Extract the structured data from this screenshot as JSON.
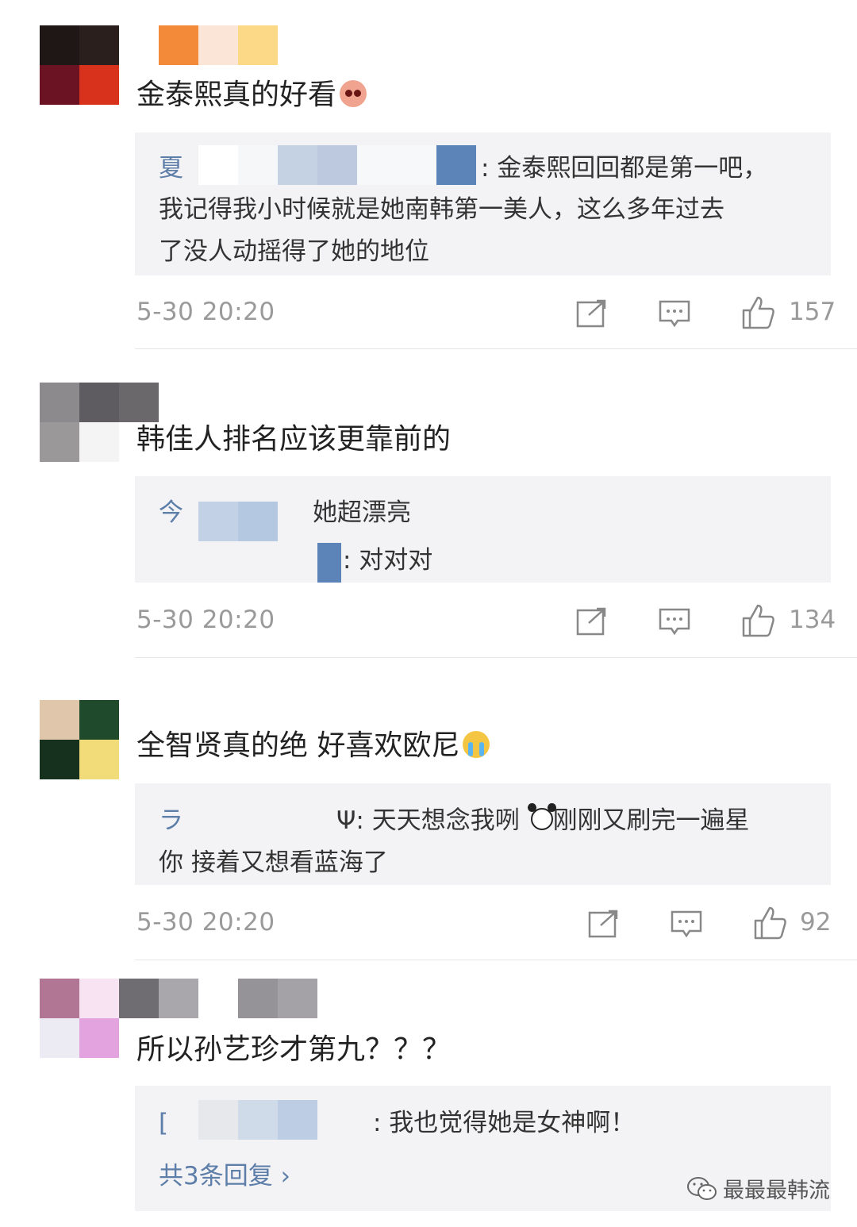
{
  "comments": [
    {
      "text": "金泰熙真的好看",
      "emoji": "pink-face-emoji",
      "reply": {
        "name_visible": "夏",
        "lines": [
          ": 金泰熙回回都是第一吧，",
          "我记得我小时候就是她南韩第一美人，这么多年过去",
          "了没人动摇得了她的地位"
        ]
      },
      "time": "5-30 20:20",
      "likes": "157"
    },
    {
      "text": "韩佳人排名应该更靠前的",
      "reply": {
        "name_visible": "今",
        "lines": [
          "她超漂亮",
          ": 对对对"
        ]
      },
      "time": "5-30 20:20",
      "likes": "134"
    },
    {
      "text": "全智贤真的绝 好喜欢欧尼",
      "emoji": "crying-face-emoji",
      "reply": {
        "name_visible": "ラ",
        "lines": [
          "Ψ: 天天想念我咧 ",
          "刚刚又刷完一遍星",
          "你 接着又想看蓝海了"
        ]
      },
      "time": "5-30 20:20",
      "likes": "92"
    },
    {
      "text": "所以孙艺珍才第九？？？",
      "reply": {
        "name_visible": "[",
        "lines": [
          ": 我也觉得她是女神啊！"
        ],
        "more": "共3条回复 ›"
      }
    }
  ],
  "watermark": "最最最韩流",
  "icons": {
    "share": "share-icon",
    "comment": "comment-icon",
    "like": "like-icon",
    "wechat": "wechat-icon"
  },
  "colors": {
    "reply_name": "#5d7ea9",
    "meta_gray": "#9a9a9a",
    "reply_bg": "#f3f3f5"
  }
}
